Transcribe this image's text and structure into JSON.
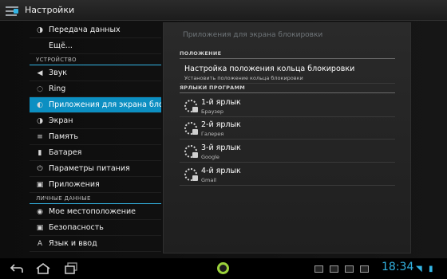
{
  "titlebar": {
    "title": "Настройки"
  },
  "sidebar": {
    "items": [
      {
        "label": "Передача данных",
        "icon": "data-usage-icon",
        "glyph": "◑"
      },
      {
        "label": "Ещё...",
        "icon": "",
        "glyph": ""
      }
    ],
    "device_header": "УСТРОЙСТВО",
    "device_items": [
      {
        "label": "Звук",
        "icon": "sound-icon",
        "glyph": "◀"
      },
      {
        "label": "Ring",
        "icon": "ring-icon",
        "glyph": "◌"
      },
      {
        "label": "Приложения для экрана блок",
        "icon": "lockscreen-apps-icon",
        "glyph": "◐",
        "active": true
      },
      {
        "label": "Экран",
        "icon": "display-icon",
        "glyph": "◑"
      },
      {
        "label": "Память",
        "icon": "storage-icon",
        "glyph": "≡"
      },
      {
        "label": "Батарея",
        "icon": "battery-icon",
        "glyph": "▮"
      },
      {
        "label": "Параметры питания",
        "icon": "power-icon",
        "glyph": "⏻"
      },
      {
        "label": "Приложения",
        "icon": "apps-icon",
        "glyph": "▣"
      }
    ],
    "personal_header": "ЛИЧНЫЕ ДАННЫЕ",
    "personal_items": [
      {
        "label": "Мое местоположение",
        "icon": "location-icon",
        "glyph": "◉"
      },
      {
        "label": "Безопасность",
        "icon": "security-icon",
        "glyph": "▣"
      },
      {
        "label": "Язык и ввод",
        "icon": "language-icon",
        "glyph": "A"
      }
    ]
  },
  "panel": {
    "title": "Приложения для экрана блокировки",
    "position_header": "ПОЛОЖЕНИЕ",
    "position_row": {
      "name": "Настройка положения кольца блокировки",
      "desc": "Установить положение кольца блокировки"
    },
    "shortcuts_header": "ЯРЛЫКИ ПРОГРАММ",
    "shortcuts": [
      {
        "name": "1-й ярлык",
        "desc": "Браузер"
      },
      {
        "name": "2-й ярлык",
        "desc": "Галерея"
      },
      {
        "name": "3-й ярлык",
        "desc": "Google"
      },
      {
        "name": "4-й ярлык",
        "desc": "Gmail"
      }
    ]
  },
  "statusbar": {
    "time": "18:34",
    "accent": "#33b5e5"
  }
}
